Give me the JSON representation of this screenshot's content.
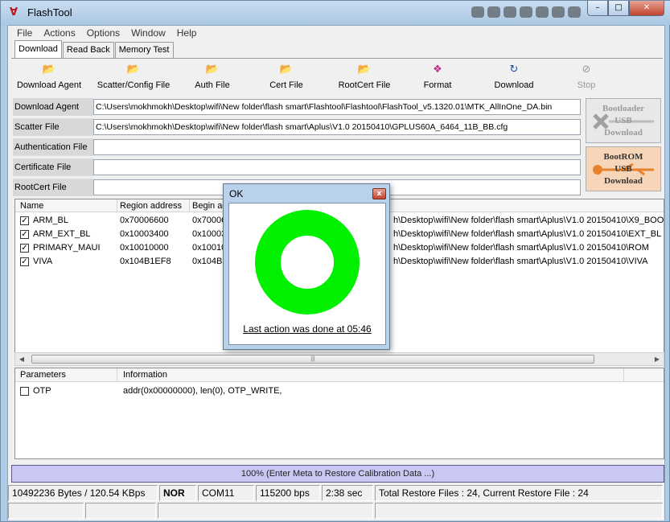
{
  "window": {
    "title": "FlashTool",
    "icon": "flashtool-logo-icon",
    "minimize": "–",
    "maximize": "□",
    "close": "✕"
  },
  "menu": [
    "File",
    "Actions",
    "Options",
    "Window",
    "Help"
  ],
  "tabs": [
    {
      "label": "Download",
      "active": true
    },
    {
      "label": "Read Back",
      "active": false
    },
    {
      "label": "Memory Test",
      "active": false
    }
  ],
  "toolbar": [
    {
      "label": "Download Agent",
      "icon": "folder-open-icon"
    },
    {
      "label": "Scatter/Config File",
      "icon": "folder-open-icon"
    },
    {
      "label": "Auth File",
      "icon": "folder-open-icon"
    },
    {
      "label": "Cert File",
      "icon": "folder-open-icon"
    },
    {
      "label": "RootCert File",
      "icon": "folder-open-icon"
    },
    {
      "label": "Format",
      "icon": "format-icon"
    },
    {
      "label": "Download",
      "icon": "download-icon"
    },
    {
      "label": "Stop",
      "icon": "stop-icon",
      "disabled": true
    }
  ],
  "files": [
    {
      "label": "Download Agent",
      "value": "C:\\Users\\mokhmokh\\Desktop\\wifi\\New folder\\flash smart\\Flashtool\\Flashtool\\FlashTool_v5.1320.01\\MTK_AllInOne_DA.bin"
    },
    {
      "label": "Scatter File",
      "value": "C:\\Users\\mokhmokh\\Desktop\\wifi\\New folder\\flash smart\\Aplus\\V1.0 20150410\\GPLUS60A_6464_11B_BB.cfg"
    },
    {
      "label": "Authentication File",
      "value": ""
    },
    {
      "label": "Certificate File",
      "value": ""
    },
    {
      "label": "RootCert File",
      "value": ""
    }
  ],
  "side_buttons": {
    "bootloader": {
      "line1": "Bootloader",
      "line2": "USB",
      "line3": "Download"
    },
    "bootrom": {
      "line1": "BootROM",
      "line2": "USB",
      "line3": "Download"
    }
  },
  "region_table": {
    "headers": [
      "Name",
      "Region address",
      "Begin ad"
    ],
    "rows": [
      {
        "checked": true,
        "name": "ARM_BL",
        "region": "0x70006600",
        "begin": "0x70006",
        "path": "h\\Desktop\\wifi\\New folder\\flash smart\\Aplus\\V1.0 20150410\\X9_BOO"
      },
      {
        "checked": true,
        "name": "ARM_EXT_BL",
        "region": "0x10003400",
        "begin": "0x10003",
        "path": "h\\Desktop\\wifi\\New folder\\flash smart\\Aplus\\V1.0 20150410\\EXT_BL"
      },
      {
        "checked": true,
        "name": "PRIMARY_MAUI",
        "region": "0x10010000",
        "begin": "0x10010",
        "path": "h\\Desktop\\wifi\\New folder\\flash smart\\Aplus\\V1.0 20150410\\ROM"
      },
      {
        "checked": true,
        "name": "VIVA",
        "region": "0x104B1EF8",
        "begin": "0x104B1",
        "path": "h\\Desktop\\wifi\\New folder\\flash smart\\Aplus\\V1.0 20150410\\VIVA"
      }
    ]
  },
  "param_table": {
    "headers": [
      "Parameters",
      "Information"
    ],
    "rows": [
      {
        "checked": false,
        "name": "OTP",
        "info": "addr(0x00000000), len(0), OTP_WRITE,"
      }
    ]
  },
  "progress": {
    "text": "100% (Enter Meta to Restore Calibration Data ...)",
    "value": 100
  },
  "statusbar": {
    "bytes": "10492236 Bytes / 120.54 KBps",
    "storage": "NOR",
    "port": "COM11",
    "baud": "115200 bps",
    "time": "2:38 sec",
    "restore": "Total Restore Files : 24, Current Restore File : 24"
  },
  "dialog": {
    "title": "OK",
    "close": "x",
    "ring_color": "#00f000",
    "message": "Last action was done at 05:46"
  },
  "colors": {
    "accent": "#aecbe6",
    "progress": "#c8c8f2",
    "bootrom": "#f7d5b8"
  }
}
